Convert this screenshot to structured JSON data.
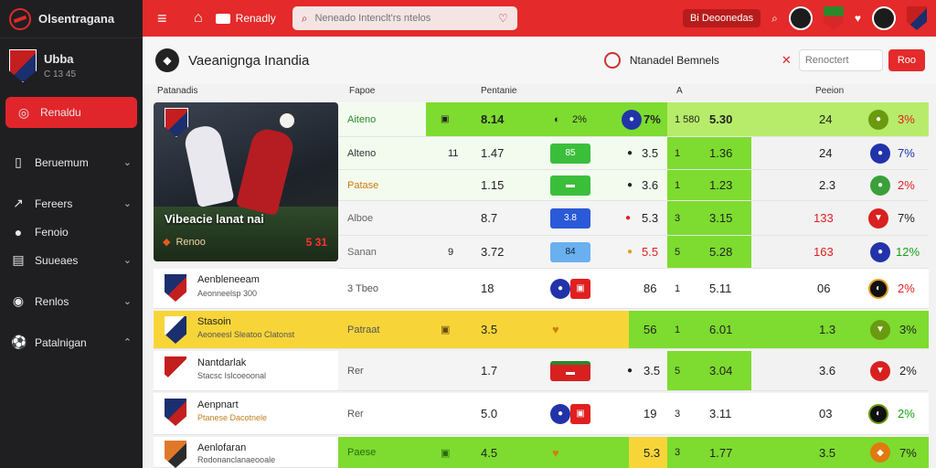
{
  "sidebar": {
    "brand": "Olsentragana",
    "club_name": "Ubba",
    "club_sub": "C 13 45",
    "active_item": "Renaldu",
    "items": [
      {
        "label": "Beruemum",
        "icon": "book-icon"
      },
      {
        "label": "Fereers",
        "icon": "arrow-icon"
      },
      {
        "label": "Fenoio",
        "icon": "ball-icon"
      },
      {
        "label": "Suueaes",
        "icon": "chart-icon"
      },
      {
        "label": "Renlos",
        "icon": "eye-icon"
      },
      {
        "label": "Patalnigan",
        "icon": "soccer-icon"
      }
    ]
  },
  "topbar": {
    "flag_label": "Renadly",
    "search_placeholder": "Neneado Intenclt'rs ntelos",
    "button_label": "Bi Deoonedas"
  },
  "subheader": {
    "title": "Vaeanignga Inandia",
    "middle_label": "Ntanadel Bemnels",
    "input_placeholder": "Renoctert",
    "button_label": "Roo"
  },
  "columns": {
    "c0": "Patanadis",
    "c1": "Fapoe",
    "c2": "Pentanie",
    "c3": "A",
    "c4": "Peeion"
  },
  "hero": {
    "title": "Vibeacie lanat nai",
    "footer": "Renoo",
    "score": "5 31"
  },
  "rows": [
    {
      "name": "Aiteno",
      "cell2": "",
      "v1": "8.14",
      "mid": "2%",
      "v2": "7%",
      "pre": "1  580",
      "v3": "5.30",
      "v4": "24",
      "pct": "3%"
    },
    {
      "name": "Alteno",
      "cell2": "11",
      "v1": "1.47",
      "mid": "85",
      "v2": "3.5",
      "pre": "1",
      "v3": "1.36",
      "v4": "24",
      "pct": "7%"
    },
    {
      "name": "Patase",
      "cell2": "",
      "v1": "1.15",
      "mid": "",
      "v2": "3.6",
      "pre": "1",
      "v3": "1.23",
      "v4": "2.3",
      "pct": "2%"
    },
    {
      "name": "Alboe",
      "cell2": "",
      "v1": "8.7",
      "mid": "3.8",
      "v2": "5.3",
      "pre": "3",
      "v3": "3.15",
      "v4": "133",
      "pct": "7%"
    },
    {
      "name": "Sanan",
      "cell2": "9",
      "v1": "3.72",
      "mid": "84",
      "v2": "5.5",
      "pre": "5",
      "v3": "5.28",
      "v4": "163",
      "pct": "12%"
    },
    {
      "name": "3 Tbeo",
      "cell2": "",
      "v1": "18",
      "mid": "",
      "v2": "86",
      "pre": "1",
      "v3": "5.11",
      "v4": "06",
      "pct": "2%"
    },
    {
      "name": "Patraat",
      "cell2": "",
      "v1": "3.5",
      "mid": "",
      "v2": "56",
      "pre": "1",
      "v3": "6.01",
      "v4": "1.3",
      "pct": "3%"
    },
    {
      "name": "Rer",
      "cell2": "",
      "v1": "1.7",
      "mid": "",
      "v2": "3.5",
      "pre": "5",
      "v3": "3.04",
      "v4": "3.6",
      "pct": "2%"
    },
    {
      "name": "Rer",
      "cell2": "",
      "v1": "5.0",
      "mid": "",
      "v2": "19",
      "pre": "3",
      "v3": "3.11",
      "v4": "03",
      "pct": "2%"
    },
    {
      "name": "Paese",
      "cell2": "",
      "v1": "4.5",
      "mid": "",
      "v2": "5.3",
      "pre": "3",
      "v3": "1.77",
      "v4": "3.5",
      "pct": "7%"
    }
  ],
  "teams": [
    {
      "name": "Aenbleneeam",
      "sub": "Aeonneelsp 300"
    },
    {
      "name": "Stasoin",
      "sub": "Aeoneesl Sleatoo Clatonst"
    },
    {
      "name": "Nantdarlak",
      "sub": "Stacsc Islcoeoonal"
    },
    {
      "name": "Aenpnart",
      "sub": "Ptanese Dacotnele"
    },
    {
      "name": "Aenlofaran",
      "sub": "Rodonanclanaeooale"
    }
  ]
}
